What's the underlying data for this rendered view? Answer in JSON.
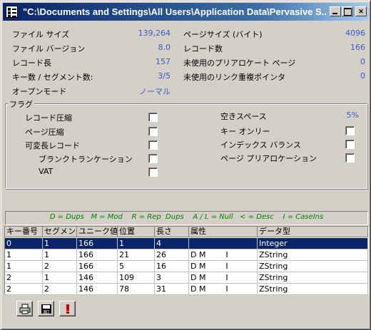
{
  "window": {
    "title": "\"C:\\Documents and Settings\\All Users\\Application Data\\Pervasive S..."
  },
  "stats_left": [
    {
      "label": "ファイル サイズ",
      "value": "139,264"
    },
    {
      "label": "ファイル バージョン",
      "value": "8.0"
    },
    {
      "label": "レコード長",
      "value": "157"
    },
    {
      "label": "キー数 / セグメント数:",
      "value": "3/5"
    },
    {
      "label": "オープンモード",
      "value": "ノーマル"
    }
  ],
  "stats_right": [
    {
      "label": "ページサイズ (バイト)",
      "value": "4096"
    },
    {
      "label": "レコード数",
      "value": "166"
    },
    {
      "label": "未使用のプリアロケート ページ",
      "value": "0"
    },
    {
      "label": "未使用のリンク重複ポインタ",
      "value": "0"
    }
  ],
  "flags": {
    "group_label": "フラグ",
    "left": [
      "レコード圧縮",
      "ページ圧縮",
      "可変長レコード",
      "ブランクトランケーション",
      "VAT"
    ],
    "right_free_space": {
      "label": "空きスペース",
      "value": "5%"
    },
    "right": [
      "キー オンリー",
      "インデックス バランス",
      "ページ プリアロケーション"
    ]
  },
  "legend": "D = Dups   M = Mod    R = Rep  Dups    A / L = Null   < = Desc    I = CaseIns",
  "table": {
    "headers": [
      "キー番号",
      "セグメント",
      "ユニーク値",
      "位置",
      "長さ",
      "属性",
      "データ型"
    ],
    "rows": [
      [
        "0",
        "1",
        "166",
        "1",
        "4",
        "",
        "Integer"
      ],
      [
        "1",
        "1",
        "166",
        "21",
        "26",
        "D M        I",
        "ZString"
      ],
      [
        "1",
        "2",
        "166",
        "5",
        "16",
        "D M        I",
        "ZString"
      ],
      [
        "2",
        "1",
        "146",
        "109",
        "3",
        "D M        I",
        "ZString"
      ],
      [
        "2",
        "2",
        "146",
        "78",
        "31",
        "D M        I",
        "ZString"
      ]
    ]
  },
  "toolbar": {
    "print_icon": "printer-icon",
    "save_icon": "floppy-disk-icon",
    "alert_icon": "exclamation-icon",
    "alert_color": "#cc0000"
  },
  "colors": {
    "value_blue": "#3a5ec8",
    "legend_green": "#008000",
    "selection": "#0a246a"
  }
}
